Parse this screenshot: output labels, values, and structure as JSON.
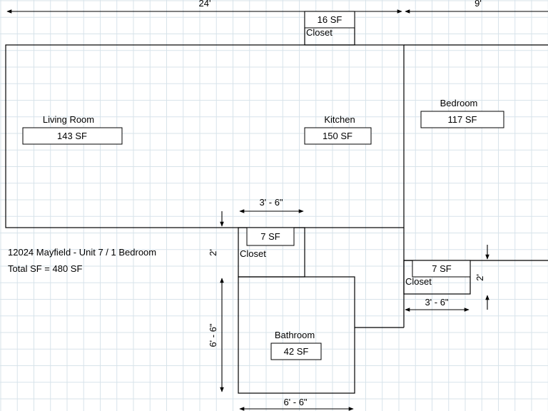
{
  "plan": {
    "title": "12024 Mayfield - Unit 7 / 1 Bedroom",
    "total": "Total SF = 480 SF"
  },
  "rooms": {
    "living": {
      "name": "Living Room",
      "area": "143 SF"
    },
    "kitchen": {
      "name": "Kitchen",
      "area": "150 SF"
    },
    "bedroom": {
      "name": "Bedroom",
      "area": "117 SF"
    },
    "bathroom": {
      "name": "Bathroom",
      "area": "42 SF"
    },
    "closet_top": {
      "name": "Closet",
      "area": "16 SF"
    },
    "closet_mid": {
      "name": "Closet",
      "area": "7 SF"
    },
    "closet_right": {
      "name": "Closet",
      "area": "7 SF"
    }
  },
  "dimensions": {
    "top_main": "24'",
    "top_bedroom": "9'",
    "closet_mid_width": "3' - 6\"",
    "closet_mid_depth": "2'",
    "closet_right_width": "3' - 6\"",
    "closet_right_depth": "2'",
    "bath_height": "6' - 6\"",
    "bath_width": "6' - 6\""
  }
}
